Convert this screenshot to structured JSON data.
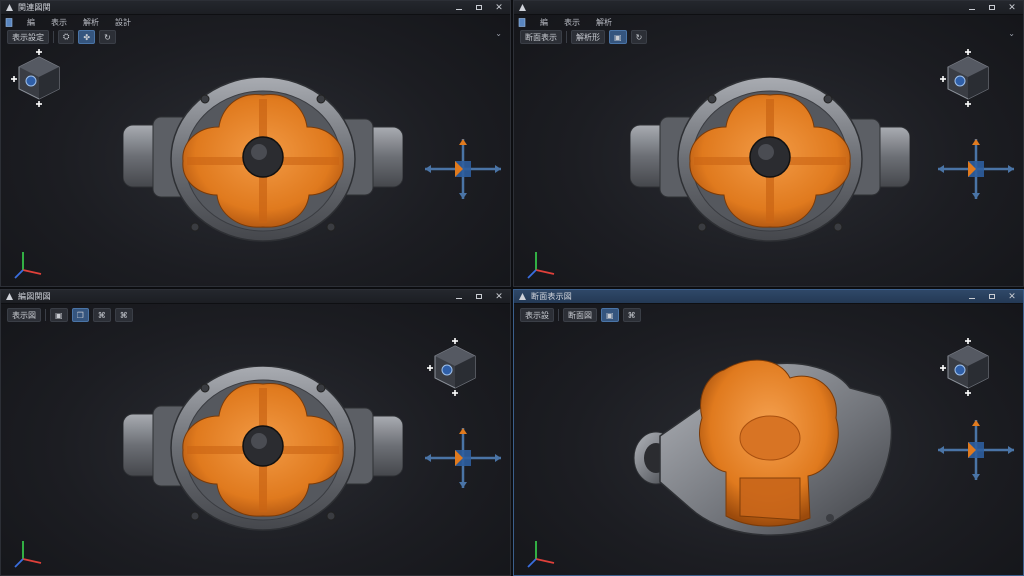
{
  "app_icon": "cad-app-icon",
  "colors": {
    "section_orange": "#e07a1e",
    "body_gray": "#8a8d93",
    "accent_blue": "#4a74a6",
    "axis_x": "#e0403a",
    "axis_y": "#36c048",
    "axis_z": "#3a6ee0"
  },
  "viewports": [
    {
      "title": "関連図関",
      "menu": [
        "編",
        "表示",
        "解析",
        "設計"
      ],
      "toolbar": [
        "表示設定",
        "⛭",
        "✤",
        "↻"
      ],
      "toolbar_more": "⌄",
      "view": "front-section",
      "window_buttons": [
        "minimize",
        "restore",
        "close"
      ]
    },
    {
      "title": "",
      "menu": [
        "編",
        "表示",
        "解析"
      ],
      "toolbar": [
        "断面表示",
        "解析形",
        "▣",
        "↻"
      ],
      "toolbar_more": "⌄",
      "view": "front-section",
      "window_buttons": [
        "minimize",
        "restore",
        "close"
      ]
    },
    {
      "title": "編図関図",
      "menu": [],
      "toolbar": [
        "表示図",
        "▣",
        "❐",
        "⌘",
        "⌘"
      ],
      "toolbar_more": "",
      "view": "front-section",
      "window_buttons": [
        "minimize",
        "restore",
        "close"
      ]
    },
    {
      "title": "断面表示図",
      "menu": [],
      "toolbar": [
        "表示設",
        "断面図",
        "▣",
        "⌘"
      ],
      "toolbar_more": "",
      "view": "iso-section",
      "window_buttons": [
        "minimize",
        "restore",
        "close"
      ]
    }
  ]
}
